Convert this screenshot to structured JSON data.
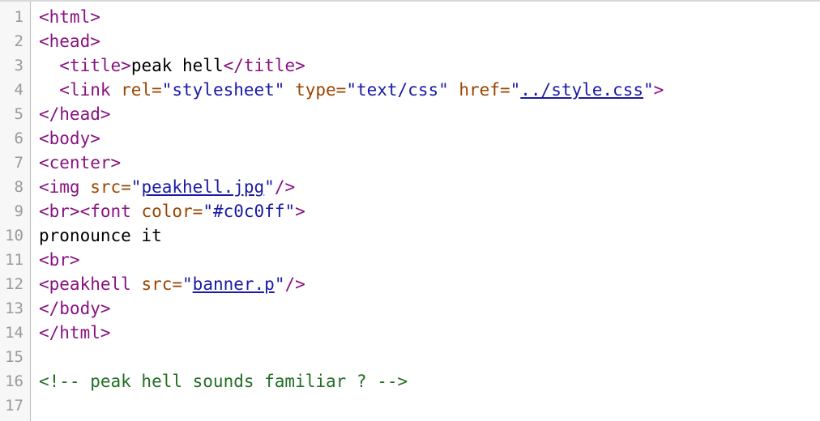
{
  "lines": [
    {
      "num": "1"
    },
    {
      "num": "2"
    },
    {
      "num": "3"
    },
    {
      "num": "4"
    },
    {
      "num": "5"
    },
    {
      "num": "6"
    },
    {
      "num": "7"
    },
    {
      "num": "8"
    },
    {
      "num": "9"
    },
    {
      "num": "10"
    },
    {
      "num": "11"
    },
    {
      "num": "12"
    },
    {
      "num": "13"
    },
    {
      "num": "14"
    },
    {
      "num": "15"
    },
    {
      "num": "16"
    },
    {
      "num": "17"
    }
  ],
  "code": {
    "l1_tag": "<html>",
    "l2_tag": "<head>",
    "l3_indent": "  ",
    "l3_open": "<title>",
    "l3_text": "peak hell",
    "l3_close": "</title>",
    "l4_indent": "  ",
    "l4_open": "<link",
    "l4_attr1": " rel=",
    "l4_val1": "\"stylesheet\"",
    "l4_attr2": " type=",
    "l4_val2": "\"text/css\"",
    "l4_attr3": " href=",
    "l4_q1": "\"",
    "l4_link": "../style.css",
    "l4_q2": "\"",
    "l4_end": ">",
    "l5_tag": "</head>",
    "l6_tag": "<body>",
    "l7_tag": "<center>",
    "l8_open": "<img",
    "l8_attr": " src=",
    "l8_q1": "\"",
    "l8_link": "peakhell.jpg",
    "l8_q2": "\"",
    "l8_end": "/>",
    "l9_tag": "<br><font",
    "l9_attr": " color=",
    "l9_val": "\"#c0c0ff\"",
    "l9_end": ">",
    "l10_text": "pronounce it",
    "l11_tag": "<br>",
    "l12_open": "<peakhell",
    "l12_attr": " src=",
    "l12_q1": "\"",
    "l12_link": "banner.p",
    "l12_q2": "\"",
    "l12_end": "/>",
    "l13_tag": "</body>",
    "l14_tag": "</html>",
    "l16_comment": "<!-- peak hell sounds familiar ? -->"
  },
  "colors": {
    "tag": "#881280",
    "attribute": "#994500",
    "value": "#1a1aa6",
    "comment": "#236e25",
    "line_number": "#999999"
  }
}
